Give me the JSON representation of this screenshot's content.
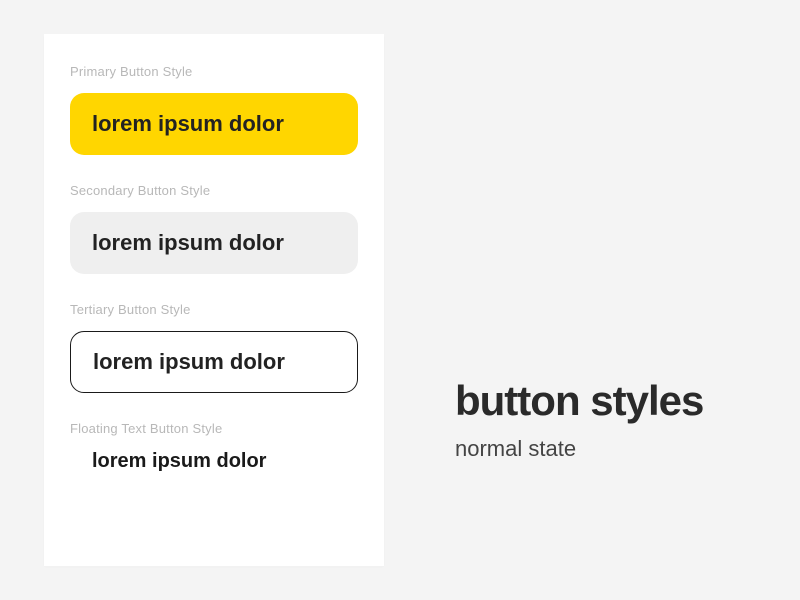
{
  "card": {
    "sections": [
      {
        "label": "Primary Button Style",
        "button_text": "lorem ipsum dolor"
      },
      {
        "label": "Secondary Button Style",
        "button_text": "lorem ipsum dolor"
      },
      {
        "label": "Tertiary Button Style",
        "button_text": "lorem ipsum dolor"
      },
      {
        "label": "Floating Text Button Style",
        "button_text": "lorem ipsum dolor"
      }
    ]
  },
  "title": {
    "heading": "button styles",
    "subheading": "normal state"
  },
  "colors": {
    "primary": "#ffd600",
    "secondary": "#efefef",
    "background": "#f4f4f4",
    "card": "#ffffff"
  }
}
